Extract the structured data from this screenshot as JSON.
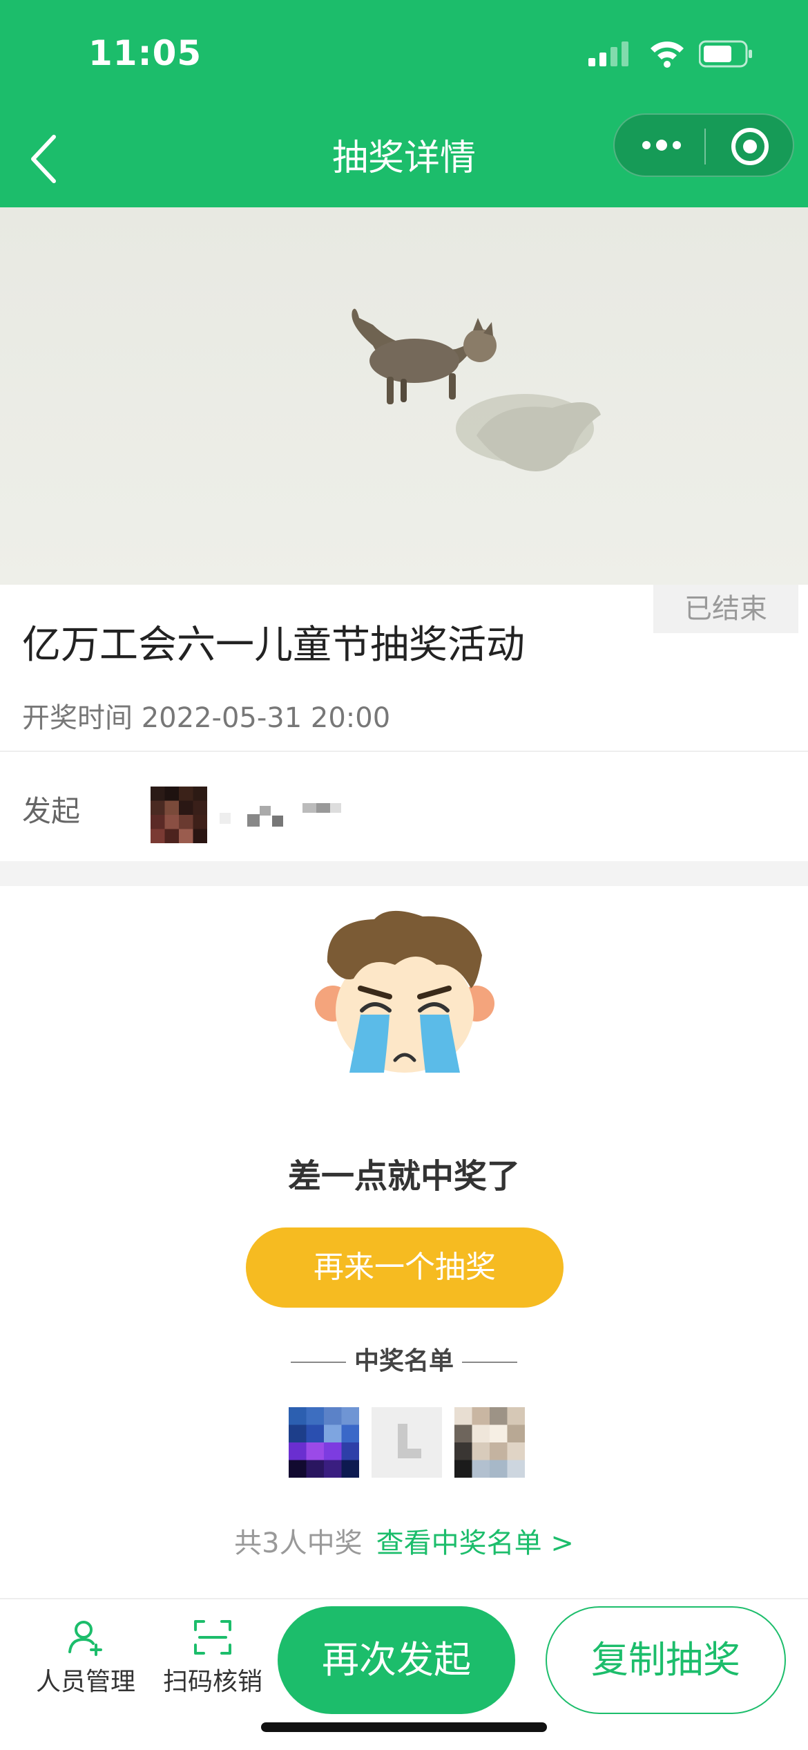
{
  "status_bar": {
    "time": "11:05"
  },
  "nav": {
    "title": "抽奖详情",
    "back_icon": "chevron-left-icon",
    "more_icon": "more-dots-icon",
    "close_icon": "target-circle-icon"
  },
  "colors": {
    "primary": "#1cbd6b",
    "retry_button": "#f6bb21"
  },
  "lottery": {
    "status_badge": "已结束",
    "title": "亿万工会六一儿童节抽奖活动",
    "draw_time_label": "开奖时间",
    "draw_time": "2022-05-31 20:00",
    "initiator_label": "发起"
  },
  "result": {
    "message": "差一点就中奖了",
    "retry_button": "再来一个抽奖",
    "winners_heading": "中奖名单",
    "winners_count_text": "共3人中奖",
    "view_winners_link": "查看中奖名单 >"
  },
  "bottom_bar": {
    "member_management": "人员管理",
    "scan_verify": "扫码核销",
    "relaunch_button": "再次发起",
    "copy_button": "复制抽奖"
  }
}
